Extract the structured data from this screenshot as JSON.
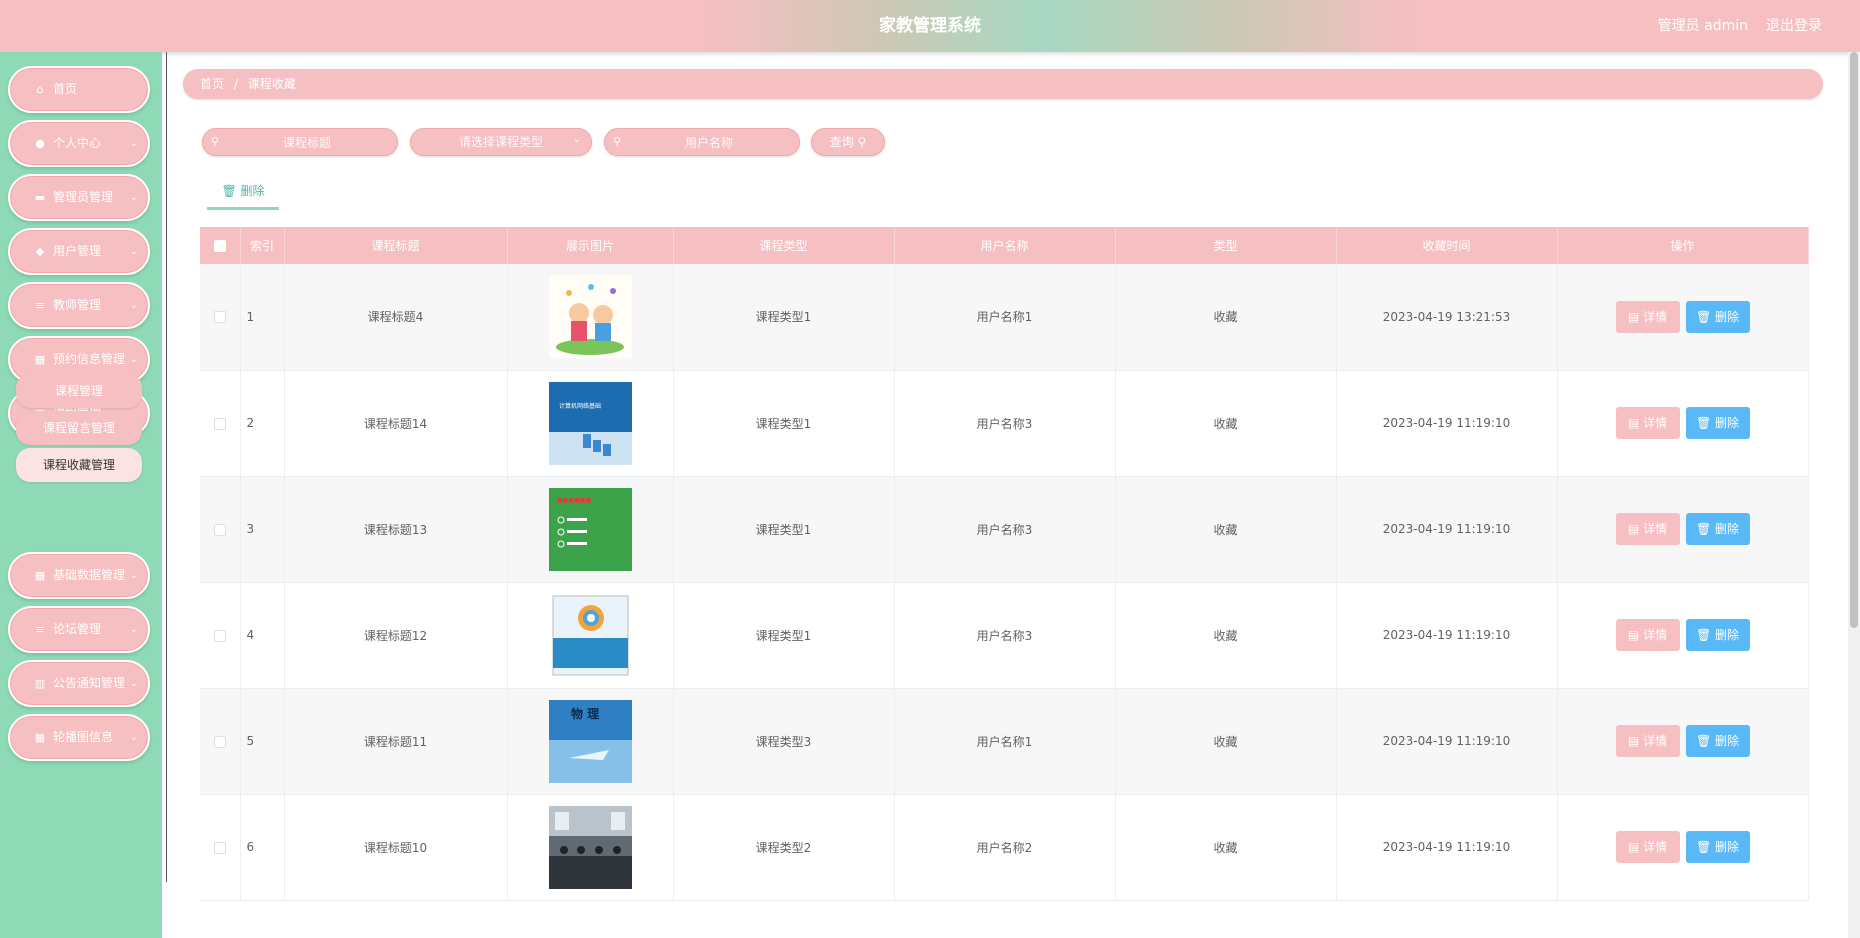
{
  "header": {
    "title": "家教管理系统",
    "user": "管理员 admin",
    "logout": "退出登录"
  },
  "sidebar": {
    "items": [
      {
        "label": "首页",
        "icon": "home-icon",
        "glyph": "⌂",
        "arrow": false
      },
      {
        "label": "个人中心",
        "icon": "user-icon",
        "glyph": "●",
        "arrow": true
      },
      {
        "label": "管理员管理",
        "icon": "chat-icon",
        "glyph": "▬",
        "arrow": true
      },
      {
        "label": "用户管理",
        "icon": "thumb-icon",
        "glyph": "◆",
        "arrow": true
      },
      {
        "label": "教师管理",
        "icon": "list-icon",
        "glyph": "≡",
        "arrow": true
      },
      {
        "label": "预约信息管理",
        "icon": "grid-icon",
        "glyph": "▦",
        "arrow": true
      },
      {
        "label": "课程管理",
        "icon": "grid-icon",
        "glyph": "▦",
        "arrow": true
      },
      {
        "label": "基础数据管理",
        "icon": "grid-icon",
        "glyph": "▦",
        "arrow": true
      },
      {
        "label": "论坛管理",
        "icon": "menu-icon",
        "glyph": "≡",
        "arrow": true
      },
      {
        "label": "公告通知管理",
        "icon": "bar-chart-icon",
        "glyph": "▥",
        "arrow": true
      },
      {
        "label": "轮播图信息",
        "icon": "grid-icon",
        "glyph": "▦",
        "arrow": true
      }
    ],
    "sub_items": [
      "课程管理",
      "课程留言管理",
      "课程收藏管理"
    ]
  },
  "breadcrumb": {
    "home": "首页",
    "sep": "/",
    "current": "课程收藏"
  },
  "search": {
    "title_placeholder": "课程标题",
    "type_placeholder": "请选择课程类型",
    "user_placeholder": "用户名称",
    "query_label": "查询"
  },
  "actions": {
    "delete_label": "删除"
  },
  "table": {
    "headers": [
      "索引",
      "课程标题",
      "展示图片",
      "课程类型",
      "用户名称",
      "类型",
      "收藏时间",
      "操作"
    ],
    "detail_label": "详情",
    "delete_label": "删除",
    "rows": [
      {
        "index": "1",
        "title": "课程标题4",
        "type": "课程类型1",
        "user": "用户名称1",
        "kind": "收藏",
        "time": "2023-04-19 13:21:53",
        "img": "cartoon"
      },
      {
        "index": "2",
        "title": "课程标题14",
        "type": "课程类型1",
        "user": "用户名称3",
        "kind": "收藏",
        "time": "2023-04-19 11:19:10",
        "img": "blue-cover",
        "img_text": "计算机网络基础"
      },
      {
        "index": "3",
        "title": "课程标题13",
        "type": "课程类型1",
        "user": "用户名称3",
        "kind": "收藏",
        "time": "2023-04-19 11:19:10",
        "img": "green-slide"
      },
      {
        "index": "4",
        "title": "课程标题12",
        "type": "课程类型1",
        "user": "用户名称3",
        "kind": "收藏",
        "time": "2023-04-19 11:19:10",
        "img": "book-cover"
      },
      {
        "index": "5",
        "title": "课程标题11",
        "type": "课程类型3",
        "user": "用户名称1",
        "kind": "收藏",
        "time": "2023-04-19 11:19:10",
        "img": "physics",
        "img_text": "物 理"
      },
      {
        "index": "6",
        "title": "课程标题10",
        "type": "课程类型2",
        "user": "用户名称2",
        "kind": "收藏",
        "time": "2023-04-19 11:19:10",
        "img": "classroom"
      }
    ]
  }
}
